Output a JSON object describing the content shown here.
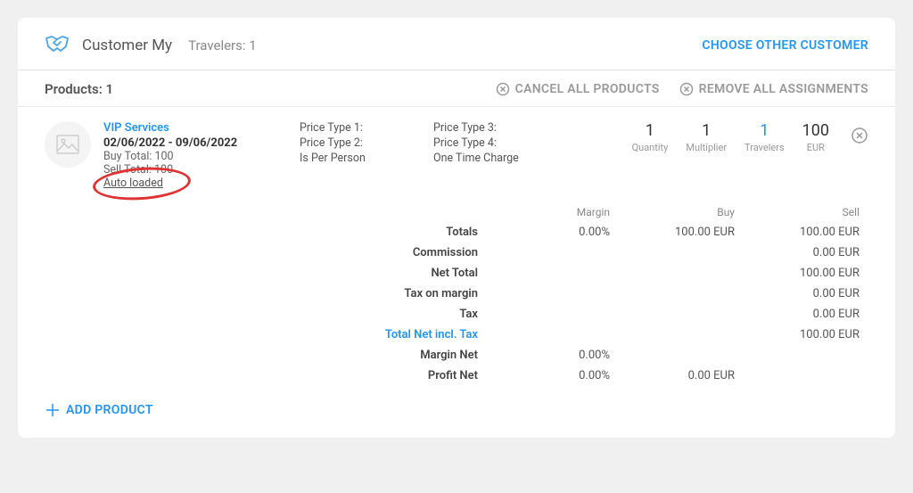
{
  "header": {
    "customer_label": "Customer My",
    "travelers_label": "Travelers: 1",
    "choose_other": "CHOOSE OTHER CUSTOMER"
  },
  "products_bar": {
    "label": "Products: 1",
    "cancel_all": "CANCEL ALL PRODUCTS",
    "remove_all": "REMOVE ALL ASSIGNMENTS"
  },
  "product": {
    "name": "VIP Services",
    "dates": "02/06/2022 - 09/06/2022",
    "buy_total": "Buy Total: 100",
    "sell_total": "Sell Total: 100",
    "auto_loaded": "Auto loaded",
    "price_type_1": "Price Type 1:",
    "price_type_2": "Price Type 2:",
    "is_per_person": "Is Per Person",
    "price_type_3": "Price Type 3:",
    "price_type_4": "Price Type 4:",
    "one_time_charge": "One Time Charge",
    "stats": {
      "quantity_val": "1",
      "quantity_lbl": "Quantity",
      "multiplier_val": "1",
      "multiplier_lbl": "Multiplier",
      "travelers_val": "1",
      "travelers_lbl": "Travelers",
      "price_val": "100",
      "price_lbl": "EUR"
    }
  },
  "totals": {
    "headers": {
      "margin": "Margin",
      "buy": "Buy",
      "sell": "Sell"
    },
    "rows": [
      {
        "label": "Totals",
        "margin": "0.00%",
        "buy": "100.00 EUR",
        "sell": "100.00 EUR"
      },
      {
        "label": "Commission",
        "margin": "",
        "buy": "",
        "sell": "0.00 EUR"
      },
      {
        "label": "Net Total",
        "margin": "",
        "buy": "",
        "sell": "100.00 EUR"
      },
      {
        "label": "Tax on margin",
        "margin": "",
        "buy": "",
        "sell": "0.00 EUR"
      },
      {
        "label": "Tax",
        "margin": "",
        "buy": "",
        "sell": "0.00 EUR"
      },
      {
        "label": "Total Net incl. Tax",
        "margin": "",
        "buy": "",
        "sell": "100.00 EUR",
        "highlight": true
      },
      {
        "label": "Margin Net",
        "margin": "0.00%",
        "buy": "",
        "sell": ""
      },
      {
        "label": "Profit Net",
        "margin": "0.00%",
        "buy": "0.00 EUR",
        "sell": ""
      }
    ]
  },
  "footer": {
    "add_product": "ADD PRODUCT"
  }
}
